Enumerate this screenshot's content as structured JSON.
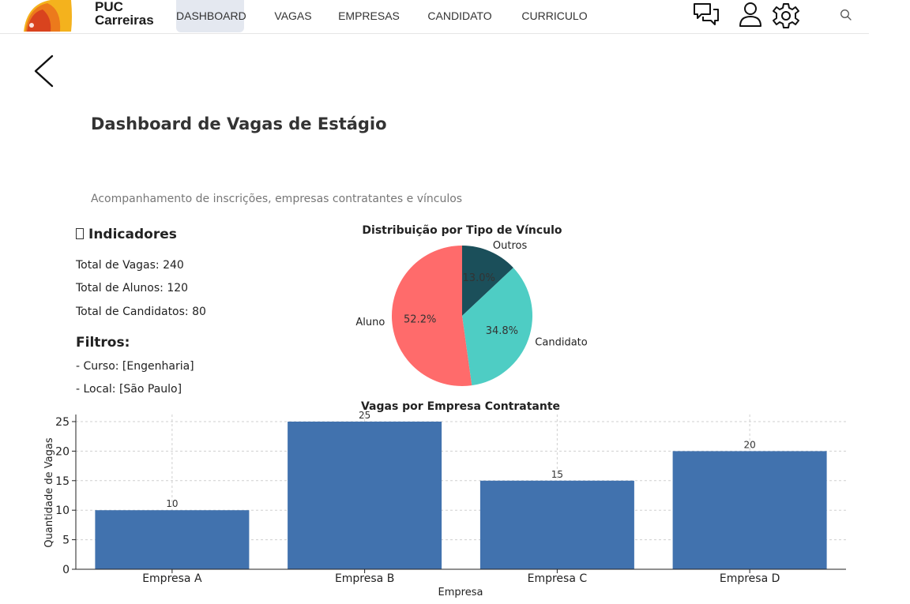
{
  "nav": {
    "logo": {
      "line1": "PUC",
      "line2": "Carreiras"
    },
    "items": [
      {
        "label": "DASHBOARD",
        "active": true
      },
      {
        "label": "VAGAS"
      },
      {
        "label": "EMPRESAS"
      },
      {
        "label": "CANDIDATO"
      },
      {
        "label": "CURRICULO"
      }
    ],
    "icons": [
      "chat-icon",
      "user-icon",
      "gear-icon",
      "search-icon"
    ]
  },
  "page": {
    "title": "Dashboard de Vagas de Estágio",
    "subtitle": "Acompanhamento de inscrições, empresas contratantes e vínculos"
  },
  "indicators": {
    "title": "Indicadores",
    "lines": [
      "Total de Vagas: 240",
      "Total de Alunos: 120",
      "Total de Candidatos: 80"
    ],
    "filters_title": "Filtros:",
    "filters": [
      "- Curso: [Engenharia]",
      "- Local: [São Paulo]"
    ]
  },
  "colors": {
    "aluno": "#ff6b6b",
    "candidato": "#4ecdc4",
    "outros": "#1b4f5a",
    "bar": "#4172ae"
  },
  "chart_data": [
    {
      "type": "pie",
      "title": "Distribuição por Tipo de Vínculo",
      "slices": [
        {
          "label": "Outros",
          "percent": 13.0,
          "pct_label": "13.0%"
        },
        {
          "label": "Candidato",
          "percent": 34.8,
          "pct_label": "34.8%"
        },
        {
          "label": "Aluno",
          "percent": 52.2,
          "pct_label": "52.2%"
        }
      ]
    },
    {
      "type": "bar",
      "title": "Vagas por Empresa Contratante",
      "categories": [
        "Empresa A",
        "Empresa B",
        "Empresa C",
        "Empresa D"
      ],
      "values": [
        10,
        25,
        15,
        20
      ],
      "value_labels": [
        "10",
        "25",
        "15",
        "20"
      ],
      "xlabel": "Empresa",
      "ylabel": "Quantidade de Vagas",
      "yticks": [
        "0",
        "5",
        "10",
        "15",
        "20",
        "25"
      ],
      "ylim": [
        0,
        26.2
      ],
      "grid": true
    }
  ]
}
